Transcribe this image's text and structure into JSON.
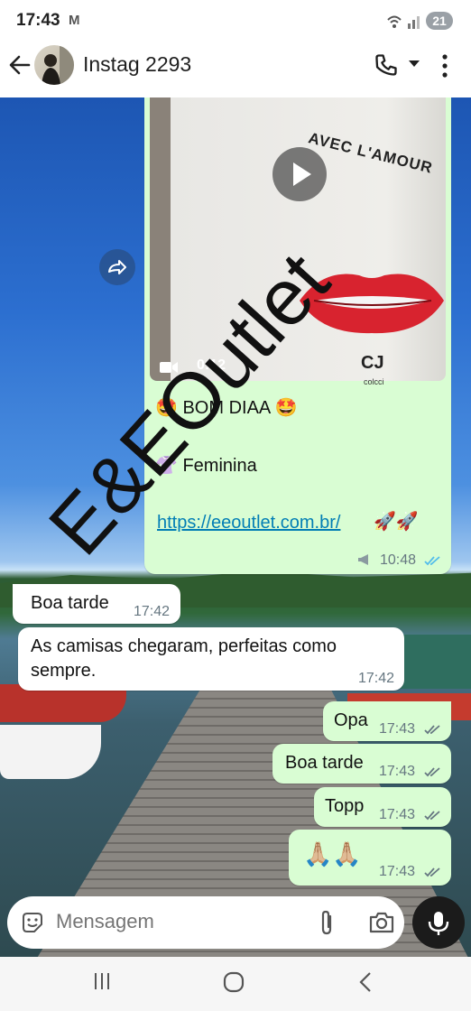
{
  "status_bar": {
    "time": "17:43",
    "mail_glyph": "M",
    "battery": "21"
  },
  "header": {
    "contact_name": "Instag 2293"
  },
  "video_message": {
    "shirt_text": "AVEC L'AMOUR",
    "brand": "CJ",
    "brand_sub": "colcci",
    "duration": "0:12",
    "lines": [
      "🤩 BOM DIAA 🤩",
      "👚 Feminina",
      "🚀🚀"
    ],
    "link": "https://eeoutlet.com.br/",
    "time": "10:48",
    "status": "read"
  },
  "messages": [
    {
      "text": "Boa tarde",
      "time": "17:42",
      "direction": "in"
    },
    {
      "text": "As camisas chegaram, perfeitas como sempre.",
      "time": "17:42",
      "direction": "in"
    },
    {
      "text": "Opa",
      "time": "17:43",
      "direction": "out",
      "status": "delivered"
    },
    {
      "text": "Boa tarde",
      "time": "17:43",
      "direction": "out",
      "status": "delivered"
    },
    {
      "text": "Topp",
      "time": "17:43",
      "direction": "out",
      "status": "delivered"
    },
    {
      "text": "🙏🏼🙏🏼",
      "time": "17:43",
      "direction": "out",
      "status": "delivered"
    }
  ],
  "watermark": "E&EOutlet",
  "composer": {
    "placeholder": "Mensagem"
  },
  "colors": {
    "outgoing": "#d9fdd3",
    "incoming": "#ffffff",
    "read_tick": "#53bdeb",
    "link": "#027eb5"
  }
}
